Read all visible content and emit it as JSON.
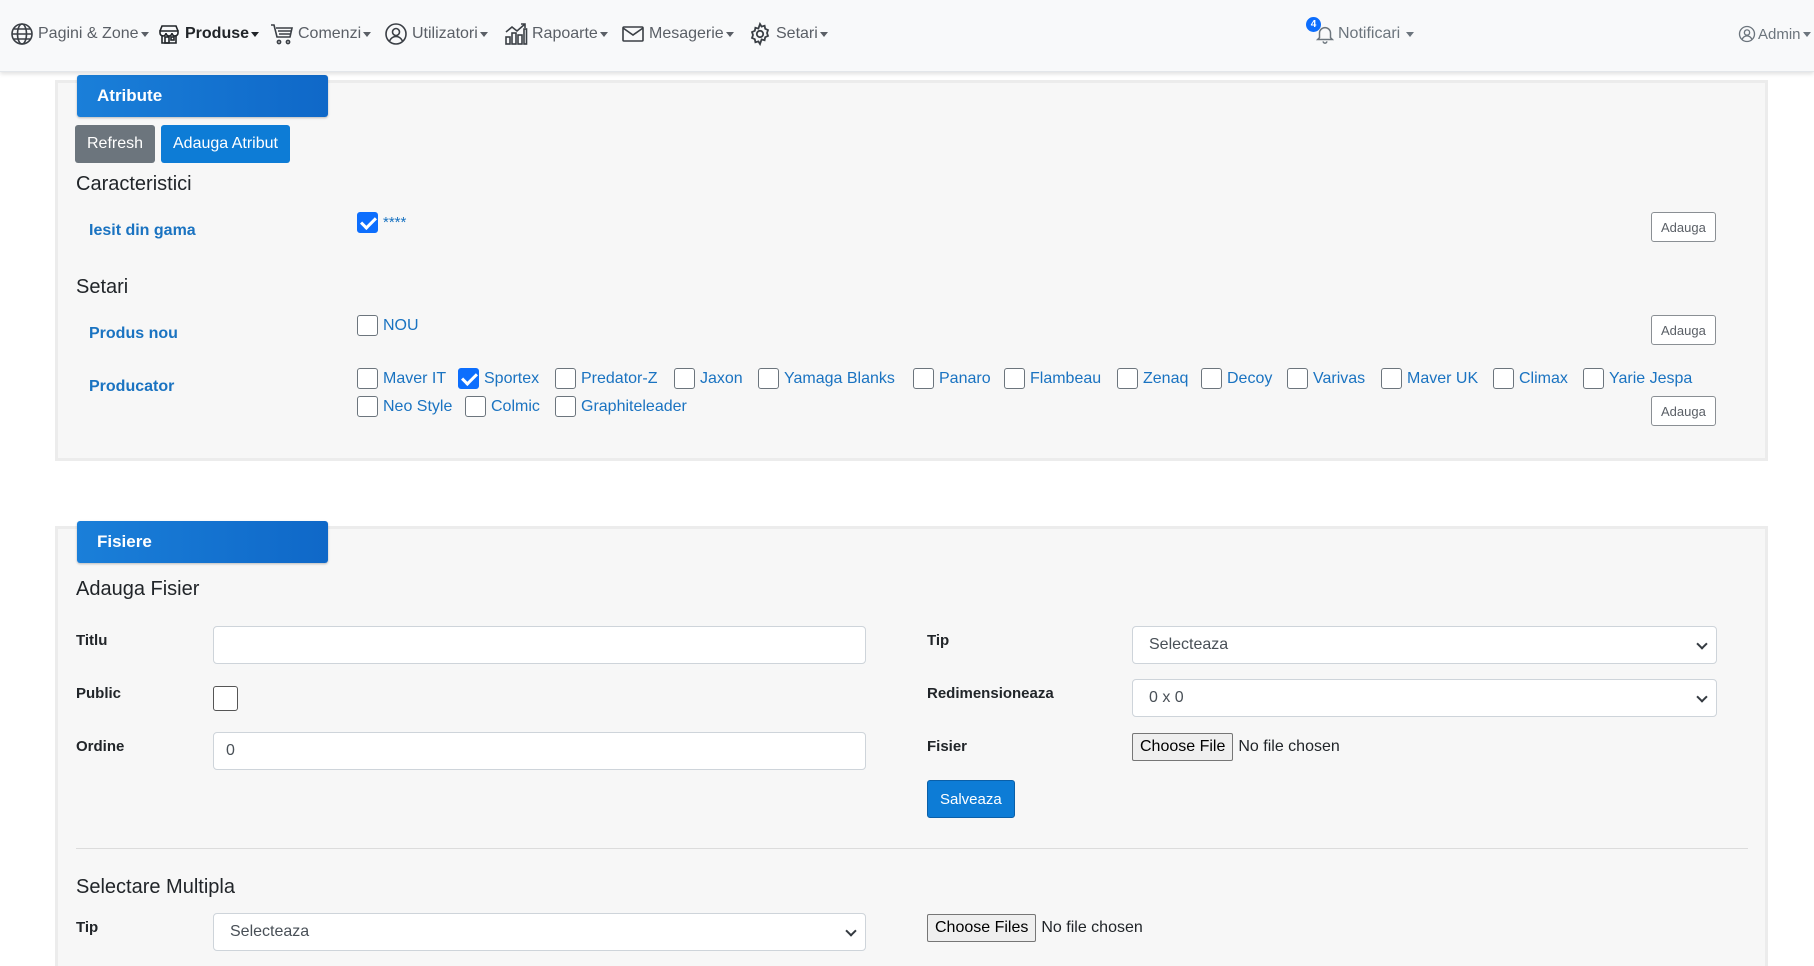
{
  "nav": {
    "items": [
      {
        "label": "Pagini & Zone",
        "icon": "globe-icon"
      },
      {
        "label": "Produse",
        "icon": "store-icon",
        "active": true
      },
      {
        "label": "Comenzi",
        "icon": "cart-icon"
      },
      {
        "label": "Utilizatori",
        "icon": "user-circle-icon"
      },
      {
        "label": "Rapoarte",
        "icon": "chart-icon"
      },
      {
        "label": "Mesagerie",
        "icon": "envelope-icon"
      },
      {
        "label": "Setari",
        "icon": "gear-icon"
      }
    ],
    "notifications": {
      "label": "Notificari",
      "count": "4"
    },
    "admin": {
      "label": "Admin"
    }
  },
  "atribute": {
    "title": "Atribute",
    "refresh_label": "Refresh",
    "add_attr_label": "Adauga Atribut",
    "caracteristici_title": "Caracteristici",
    "iesit": {
      "label": "Iesit din gama",
      "option": "****",
      "checked": true,
      "add_label": "Adauga"
    },
    "setari_title": "Setari",
    "produs_nou": {
      "label": "Produs nou",
      "option": "NOU",
      "checked": false,
      "add_label": "Adauga"
    },
    "producator": {
      "label": "Producator",
      "add_label": "Adauga",
      "options": [
        {
          "label": "Maver IT",
          "checked": false
        },
        {
          "label": "Sportex",
          "checked": true
        },
        {
          "label": "Predator-Z",
          "checked": false
        },
        {
          "label": "Jaxon",
          "checked": false
        },
        {
          "label": "Yamaga Blanks",
          "checked": false
        },
        {
          "label": "Panaro",
          "checked": false
        },
        {
          "label": "Flambeau",
          "checked": false
        },
        {
          "label": "Zenaq",
          "checked": false
        },
        {
          "label": "Decoy",
          "checked": false
        },
        {
          "label": "Varivas",
          "checked": false
        },
        {
          "label": "Maver UK",
          "checked": false
        },
        {
          "label": "Climax",
          "checked": false
        },
        {
          "label": "Yarie Jespa",
          "checked": false
        },
        {
          "label": "Neo Style",
          "checked": false
        },
        {
          "label": "Colmic",
          "checked": false
        },
        {
          "label": "Graphiteleader",
          "checked": false
        }
      ]
    }
  },
  "fisiere": {
    "title": "Fisiere",
    "adauga_title": "Adauga Fisier",
    "titlu_label": "Titlu",
    "titlu_value": "",
    "public_label": "Public",
    "ordine_label": "Ordine",
    "ordine_value": "0",
    "tip_label": "Tip",
    "tip_value": "Selecteaza",
    "redim_label": "Redimensioneaza",
    "redim_value": "0 x 0",
    "fisier_label": "Fisier",
    "choose_file": "Choose File",
    "no_file": "No file chosen",
    "save_label": "Salveaza",
    "multi_title": "Selectare Multipla",
    "multi_tip_label": "Tip",
    "multi_tip_value": "Selecteaza",
    "choose_files": "Choose Files",
    "multi_no_file": "No file chosen"
  }
}
